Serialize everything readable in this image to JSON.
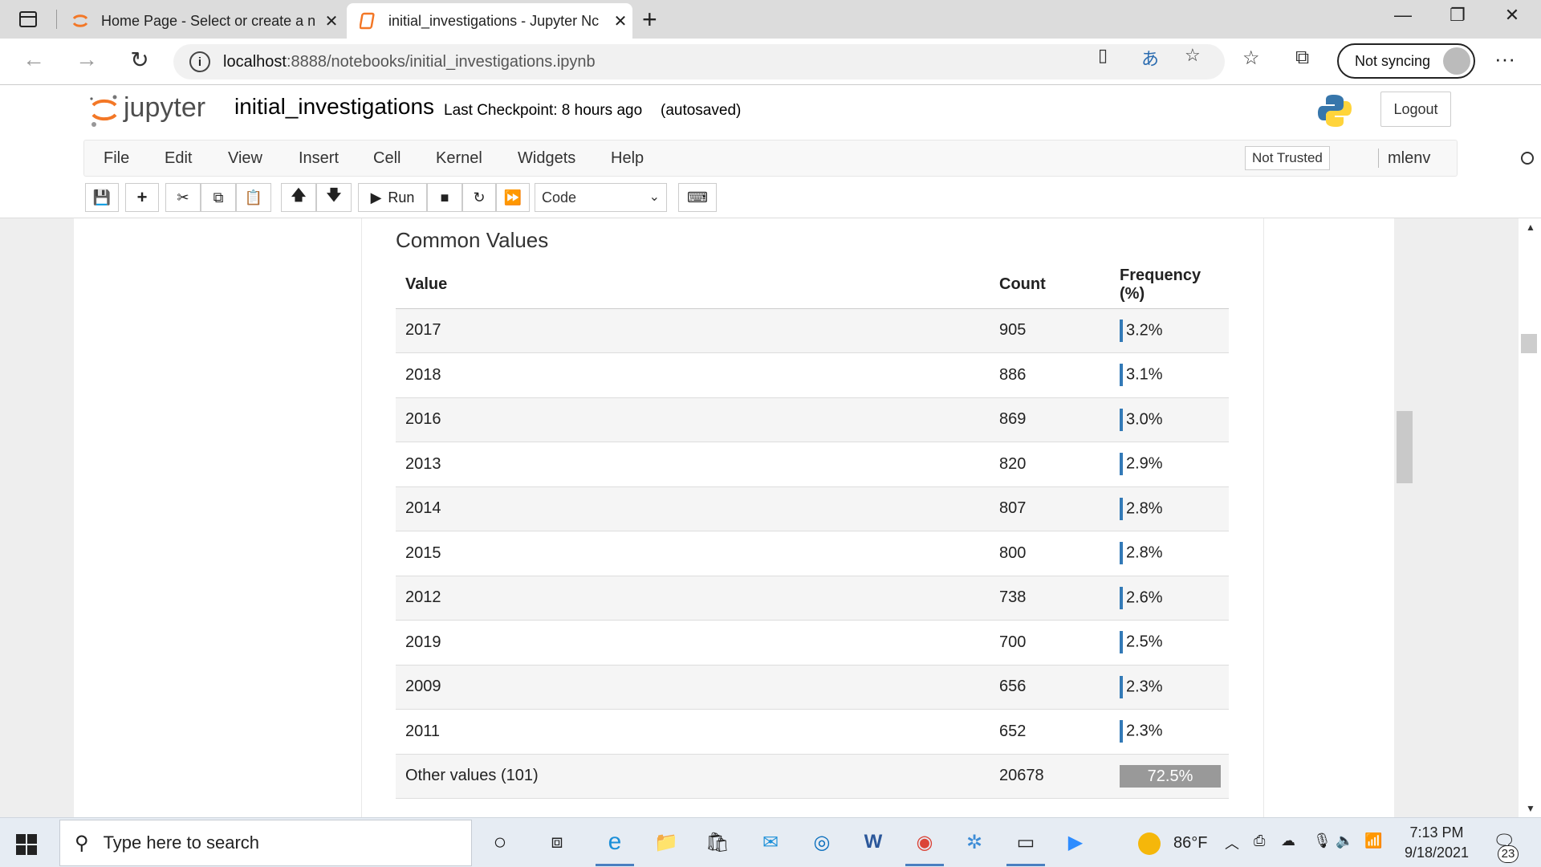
{
  "browser": {
    "tabs": [
      {
        "title": "Home Page - Select or create a n"
      },
      {
        "title": "initial_investigations - Jupyter Nc"
      }
    ],
    "url_host": "localhost",
    "url_path": ":8888/notebooks/initial_investigations.ipynb",
    "sync_label": "Not syncing"
  },
  "jupyter": {
    "logo_text": "jupyter",
    "notebook_name": "initial_investigations",
    "checkpoint": "Last Checkpoint: 8 hours ago",
    "autosave": "(autosaved)",
    "logout": "Logout",
    "menu": [
      "File",
      "Edit",
      "View",
      "Insert",
      "Cell",
      "Kernel",
      "Widgets",
      "Help"
    ],
    "trust": "Not Trusted",
    "kernel": "mlenv",
    "toolbar": {
      "run_label": "Run",
      "cell_type": "Code"
    }
  },
  "output": {
    "heading": "Common Values",
    "columns": [
      "Value",
      "Count",
      "Frequency (%)"
    ],
    "rows": [
      {
        "value": "2017",
        "count": "905",
        "freq": "3.2%"
      },
      {
        "value": "2018",
        "count": "886",
        "freq": "3.1%"
      },
      {
        "value": "2016",
        "count": "869",
        "freq": "3.0%"
      },
      {
        "value": "2013",
        "count": "820",
        "freq": "2.9%"
      },
      {
        "value": "2014",
        "count": "807",
        "freq": "2.8%"
      },
      {
        "value": "2015",
        "count": "800",
        "freq": "2.8%"
      },
      {
        "value": "2012",
        "count": "738",
        "freq": "2.6%"
      },
      {
        "value": "2019",
        "count": "700",
        "freq": "2.5%"
      },
      {
        "value": "2009",
        "count": "656",
        "freq": "2.3%"
      },
      {
        "value": "2011",
        "count": "652",
        "freq": "2.3%"
      }
    ],
    "other": {
      "value": "Other values (101)",
      "count": "20678",
      "freq": "72.5%"
    }
  },
  "taskbar": {
    "search_placeholder": "Type here to search",
    "temperature": "86°F",
    "time": "7:13 PM",
    "date": "9/18/2021",
    "notification_count": "23"
  },
  "colors": {
    "accent_bar": "#337ab7",
    "other_bar": "#999999",
    "jupyter_orange": "#f37726"
  }
}
